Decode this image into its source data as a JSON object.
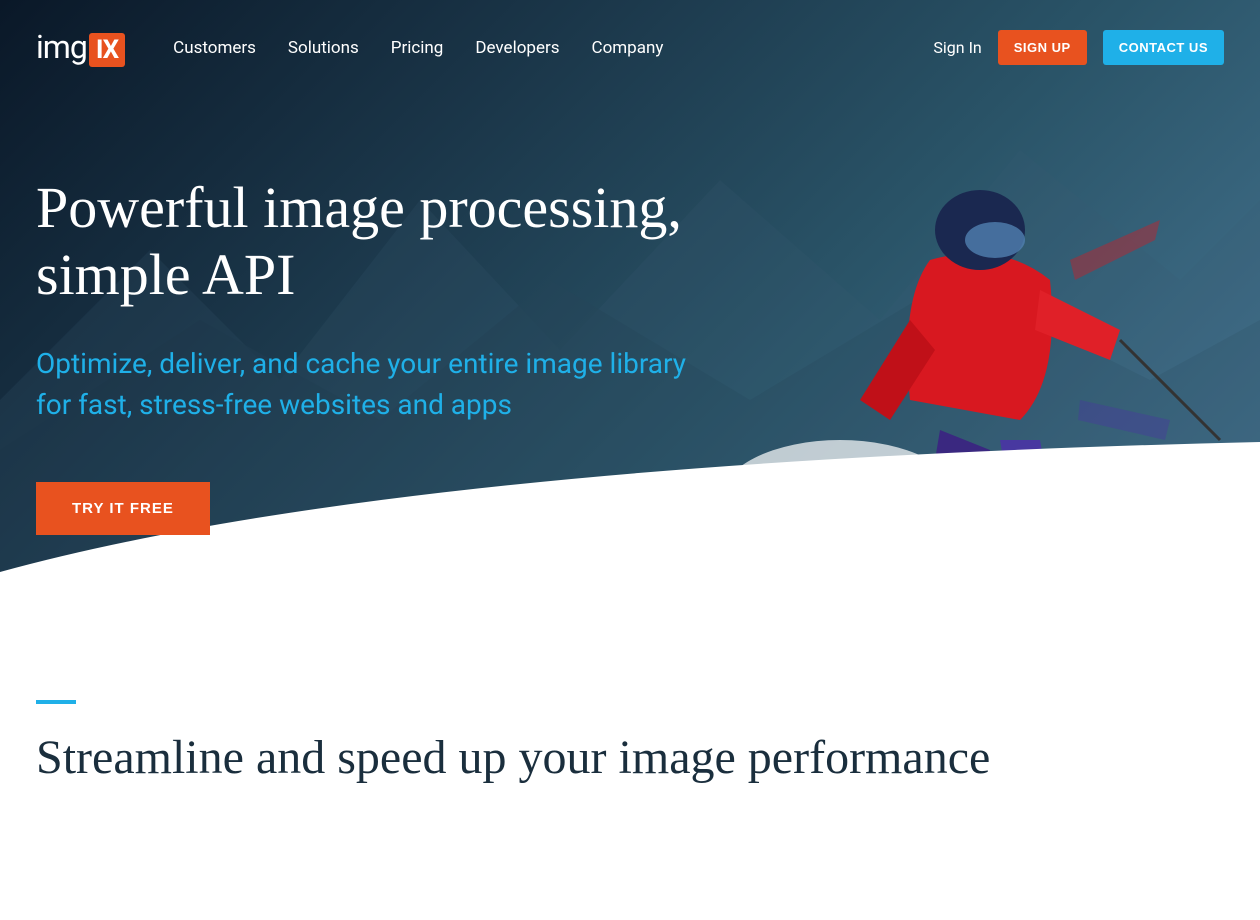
{
  "logo": {
    "text": "img",
    "box": "IX"
  },
  "nav": {
    "items": [
      "Customers",
      "Solutions",
      "Pricing",
      "Developers",
      "Company"
    ]
  },
  "header": {
    "signin": "Sign In",
    "signup": "SIGN UP",
    "contact": "CONTACT US"
  },
  "hero": {
    "title": "Powerful image processing, simple API",
    "subtitle": "Optimize, deliver, and cache your entire image library for fast, stress-free websites and apps",
    "cta": "TRY IT FREE"
  },
  "section2": {
    "title": "Streamline and speed up your image performance"
  },
  "colors": {
    "orange": "#e8521f",
    "blue": "#1fb0e8",
    "dark": "#0a1828"
  }
}
